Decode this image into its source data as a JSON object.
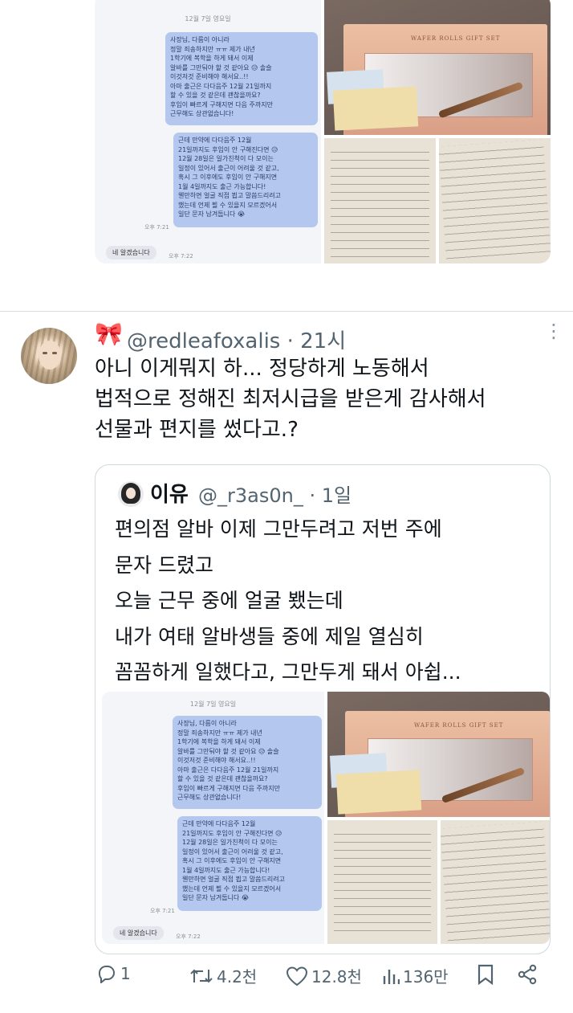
{
  "top_media": {
    "chat": {
      "date": "12월 7일 영요일",
      "bubble1": "사장님, 다름이 아니라\n정말 죄송하지만 ㅠㅠ 제가 내년\n1학기에 복학을 하게 돼서 이제\n알바를 그만둬야 할 것 같아요 😥 솔슬\n이것저것 준비해야 해서요..!!\n아마 출근은 다다음주 12월 21일까지\n할 수 있을 것 같은데 괜찮을까요?\n후임이 빠르게 구해지면 다음 주까지만\n근무해도 상관없습니다!",
      "bubble2": "근데 만약에 다다음주 12월\n21일까지도 후임이 안 구해진다면 😥\n12월 28일은 일가친척이 다 모이는\n일정이 있어서 출근이 어려울 것 같고,\n혹시 그 이후에도 후임이 안 구해지면\n1월 4일까지도 출근 가능합니다!\n웬만하면 얼굴 직접 뵙고 말씀드리려고\n했는데 언제 뵐 수 있을지 모르겠어서\n일단 문자 남겨둡니다 😭",
      "sent_time": "오후 7:21",
      "reply": "네 알겠습니다",
      "reply_time": "오후 7:22"
    },
    "box_label": "WAFER ROLLS GIFT SET"
  },
  "tweet": {
    "handle_line": "@redleafoxalis · 21시",
    "text": "아니 이게뭐지 하... 정당하게 노동해서\n법적으로 정해진 최저시급을 받은게 감사해서\n선물과 편지를 썼다고.?"
  },
  "quote": {
    "name": "이유",
    "handle_line": "@_r3as0n_ · 1일",
    "text": "편의점 알바 이제 그만두려고 저번 주에\n문자 드렸고\n오늘 근무 중에 얼굴 뵀는데\n내가 여태 알바생들 중에 제일 열심히\n꼼꼼하게 일했다고, 그만두게 돼서 아쉽...",
    "chat": {
      "date": "12월 7일 영요일",
      "bubble1": "사장님, 다름이 아니라\n정말 죄송하지만 ㅠㅠ 제가 내년\n1학기에 복학을 하게 돼서 이제\n알바를 그만둬야 할 것 같아요 😥 솔슬\n이것저것 준비해야 해서요..!!\n아마 출근은 다다음주 12월 21일까지\n할 수 있을 것 같은데 괜찮을까요?\n후임이 빠르게 구해지면 다음 주까지만\n근무해도 상관없습니다!",
      "bubble2": "근데 만약에 다다음주 12월\n21일까지도 후임이 안 구해진다면 😥\n12월 28일은 일가친척이 다 모이는\n일정이 있어서 출근이 어려울 것 같고,\n혹시 그 이후에도 후임이 안 구해지면\n1월 4일까지도 출근 가능합니다!\n웬만하면 얼굴 직접 뵙고 말씀드리려고\n했는데 언제 뵐 수 있을지 모르겠어서\n일단 문자 남겨둡니다 😭",
      "sent_time": "오후 7:21",
      "reply": "네 알겠습니다",
      "reply_time": "오후 7:22"
    },
    "box_label": "WAFER ROLLS GIFT SET"
  },
  "actions": {
    "replies": "1",
    "retweets": "4.2천",
    "likes": "12.8천",
    "views": "136만"
  },
  "icons": {
    "reply": "reply-icon",
    "retweet": "retweet-icon",
    "like": "heart-icon",
    "views": "views-icon",
    "bookmark": "bookmark-icon",
    "share": "share-icon",
    "more": "more-icon"
  },
  "colors": {
    "bubble": "#b4c7ee",
    "text": "#0f1419",
    "muted": "#536471",
    "bow": "#e06a8a"
  }
}
